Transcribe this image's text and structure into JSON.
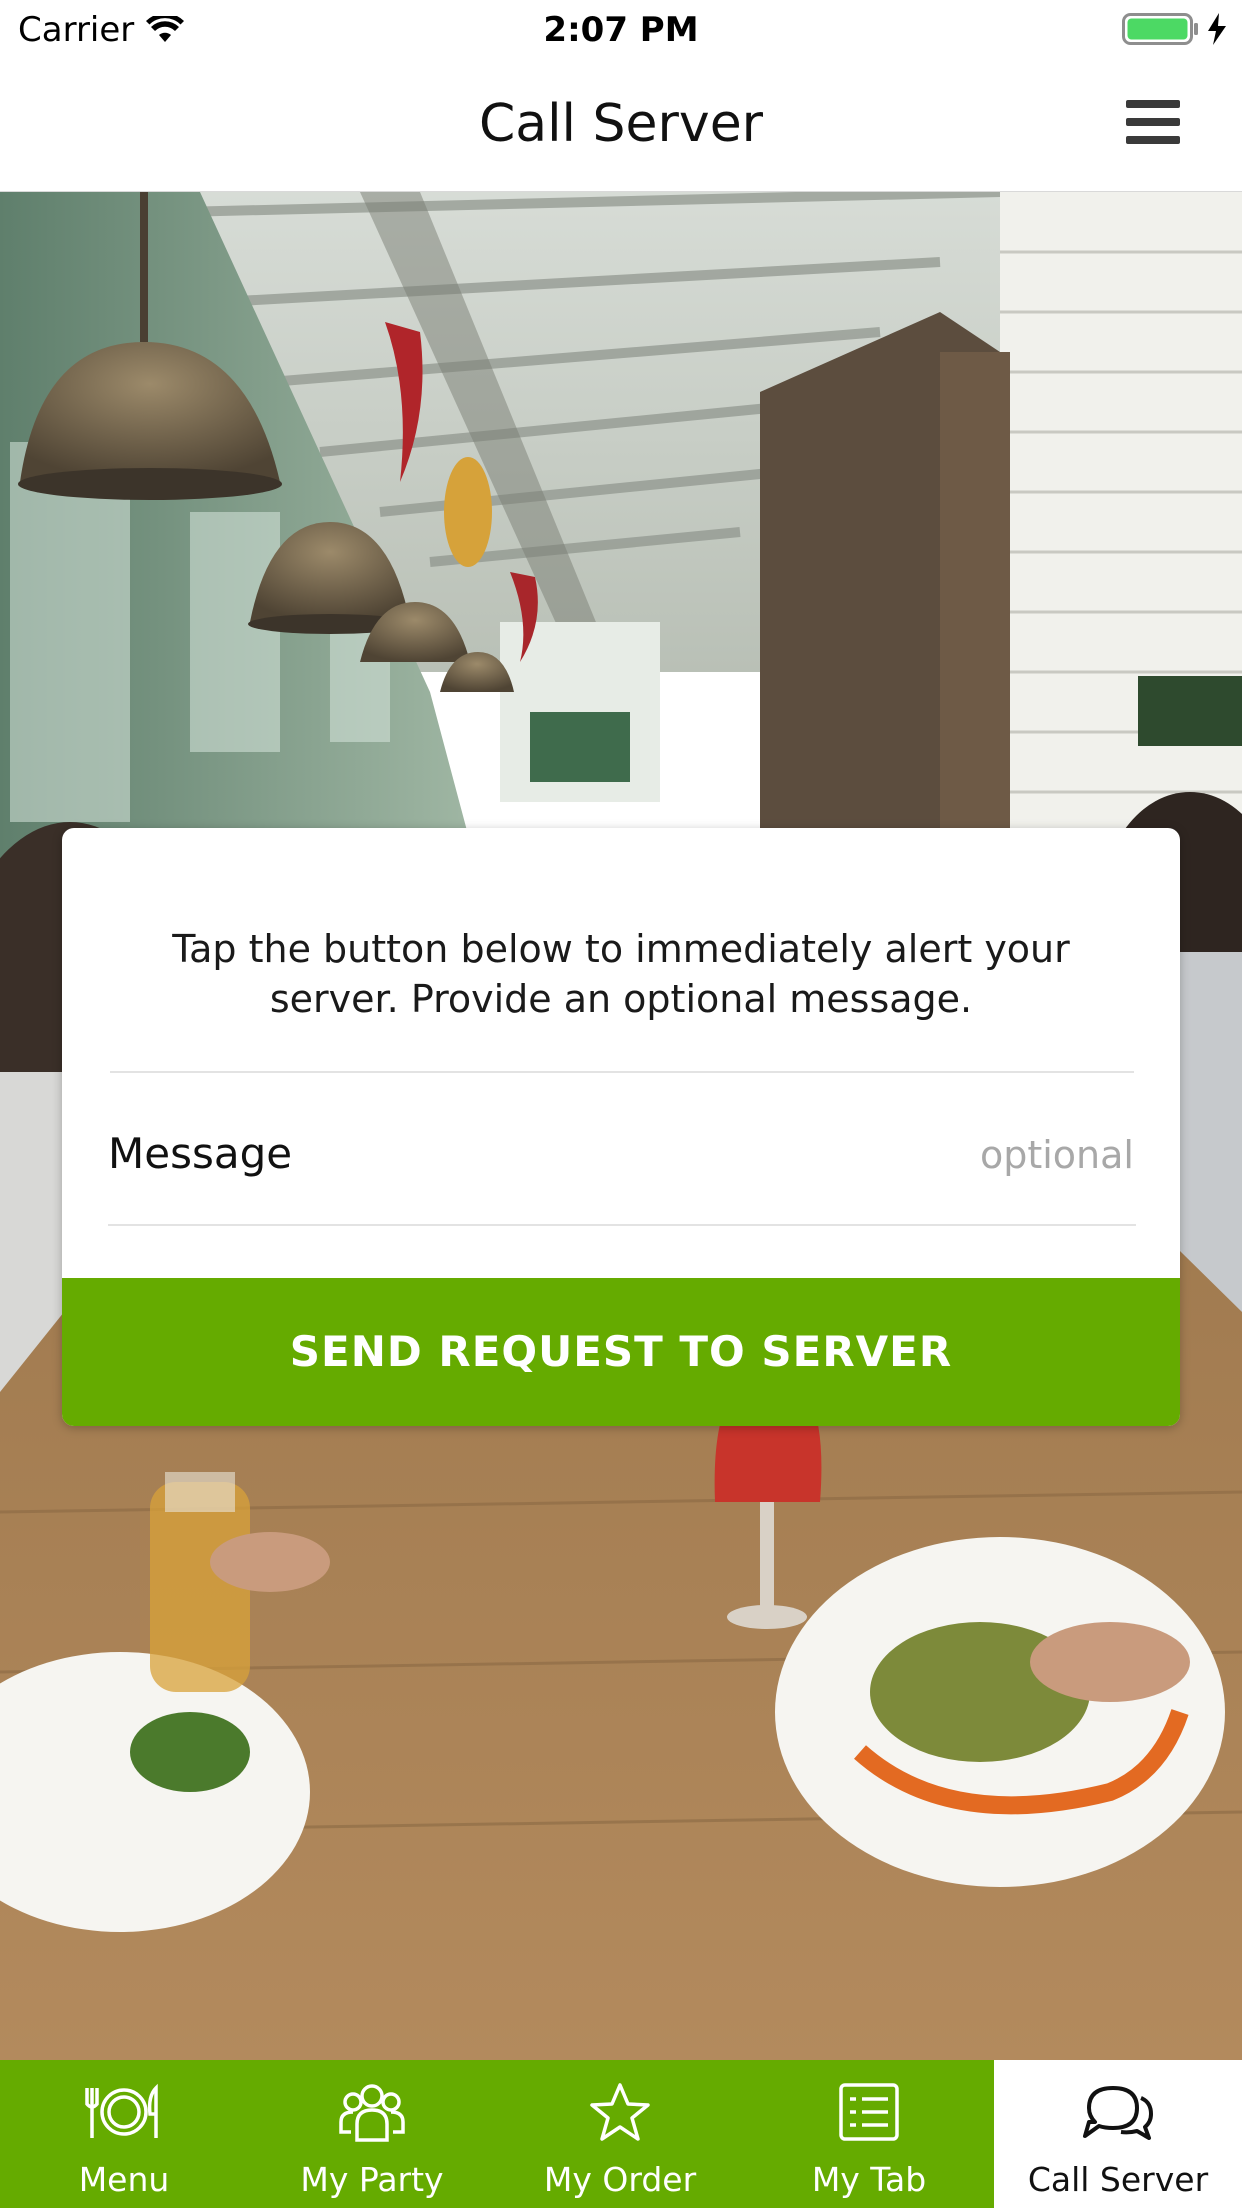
{
  "status_bar": {
    "carrier": "Carrier",
    "time": "2:07 PM",
    "battery_color": "#4cd964"
  },
  "nav": {
    "title": "Call Server"
  },
  "card": {
    "instructions": "Tap the button below to immediately alert your server. Provide an optional message.",
    "message_label": "Message",
    "message_placeholder": "optional",
    "message_value": "",
    "send_button_label": "SEND REQUEST TO SERVER"
  },
  "tabs": [
    {
      "label": "Menu",
      "icon": "utensils-plate-icon",
      "active": false
    },
    {
      "label": "My Party",
      "icon": "group-icon",
      "active": false
    },
    {
      "label": "My Order",
      "icon": "star-icon",
      "active": false
    },
    {
      "label": "My Tab",
      "icon": "receipt-list-icon",
      "active": false
    },
    {
      "label": "Call Server",
      "icon": "chat-bubbles-icon",
      "active": true
    }
  ],
  "colors": {
    "brand_green": "#65ab00",
    "nav_text": "#111111",
    "placeholder": "#a8a8a8"
  }
}
